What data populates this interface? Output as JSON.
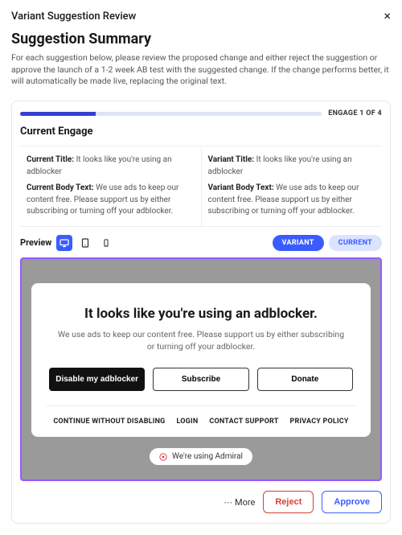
{
  "header": {
    "title": "Variant Suggestion Review"
  },
  "summary": {
    "title": "Suggestion Summary",
    "description": "For each suggestion below, please review the proposed change and either reject the suggestion or approve the launch of a 1-2 week AB test with the suggested change. If the change performs better, it will automatically be made live, replacing the original text."
  },
  "card": {
    "progress_label": "ENGAGE 1 OF 4",
    "section_title": "Current Engage",
    "current": {
      "title_label": "Current Title:",
      "title_value": "It looks like you're using an adblocker",
      "body_label": "Current Body Text:",
      "body_value": "We use ads to keep our content free. Please support us by either subscribing or turning off your adblocker."
    },
    "variant": {
      "title_label": "Variant Title:",
      "title_value": "It looks like you're using an adblocker",
      "body_label": "Variant Body Text:",
      "body_value": "We use ads to keep our content free. Please support us by either subscribing or turning off your adblocker."
    },
    "toolbar": {
      "preview_label": "Preview",
      "variant_btn": "VARIANT",
      "current_btn": "CURRENT"
    },
    "preview": {
      "title": "It looks like you're using an adblocker.",
      "body": "We use ads to keep our content free. Please support us by either subscribing or turning off your adblocker.",
      "cta_disable": "Disable my adblocker",
      "cta_subscribe": "Subscribe",
      "cta_donate": "Donate",
      "link_continue": "CONTINUE WITHOUT DISABLING",
      "link_login": "LOGIN",
      "link_contact": "CONTACT SUPPORT",
      "link_privacy": "PRIVACY POLICY",
      "admiral_badge": "We're using Admiral"
    },
    "footer": {
      "more": "More",
      "reject": "Reject",
      "approve": "Approve"
    }
  }
}
